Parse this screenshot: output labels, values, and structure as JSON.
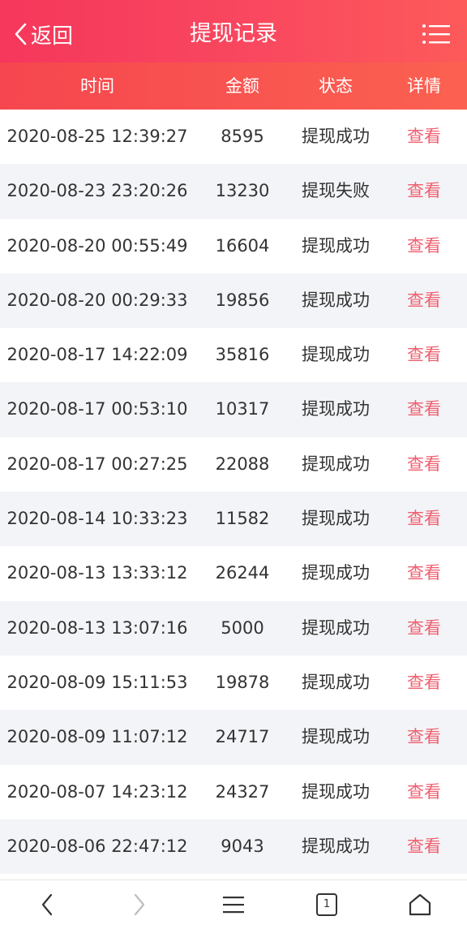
{
  "header": {
    "back_label": "返回",
    "title": "提现记录"
  },
  "columns": {
    "time": "时间",
    "amount": "金额",
    "status": "状态",
    "detail": "详情"
  },
  "rows": [
    {
      "time": "2020-08-25 12:39:27",
      "amount": "8595",
      "status": "提现成功",
      "detail": "查看"
    },
    {
      "time": "2020-08-23 23:20:26",
      "amount": "13230",
      "status": "提现失败",
      "detail": "查看"
    },
    {
      "time": "2020-08-20 00:55:49",
      "amount": "16604",
      "status": "提现成功",
      "detail": "查看"
    },
    {
      "time": "2020-08-20 00:29:33",
      "amount": "19856",
      "status": "提现成功",
      "detail": "查看"
    },
    {
      "time": "2020-08-17 14:22:09",
      "amount": "35816",
      "status": "提现成功",
      "detail": "查看"
    },
    {
      "time": "2020-08-17 00:53:10",
      "amount": "10317",
      "status": "提现成功",
      "detail": "查看"
    },
    {
      "time": "2020-08-17 00:27:25",
      "amount": "22088",
      "status": "提现成功",
      "detail": "查看"
    },
    {
      "time": "2020-08-14 10:33:23",
      "amount": "11582",
      "status": "提现成功",
      "detail": "查看"
    },
    {
      "time": "2020-08-13 13:33:12",
      "amount": "26244",
      "status": "提现成功",
      "detail": "查看"
    },
    {
      "time": "2020-08-13 13:07:16",
      "amount": "5000",
      "status": "提现成功",
      "detail": "查看"
    },
    {
      "time": "2020-08-09 15:11:53",
      "amount": "19878",
      "status": "提现成功",
      "detail": "查看"
    },
    {
      "time": "2020-08-09 11:07:12",
      "amount": "24717",
      "status": "提现成功",
      "detail": "查看"
    },
    {
      "time": "2020-08-07 14:23:12",
      "amount": "24327",
      "status": "提现成功",
      "detail": "查看"
    },
    {
      "time": "2020-08-06 22:47:12",
      "amount": "9043",
      "status": "提现成功",
      "detail": "查看"
    }
  ],
  "bottom_bar": {
    "tab_count": "1",
    "icons": [
      "back-arrow-icon",
      "forward-arrow-icon",
      "menu-icon",
      "tabs-icon",
      "home-icon"
    ]
  },
  "colors": {
    "header_start": "#f5375b",
    "header_end": "#fd5a5a",
    "detail_link": "#f06070",
    "row_alt": "#f3f4f7"
  }
}
